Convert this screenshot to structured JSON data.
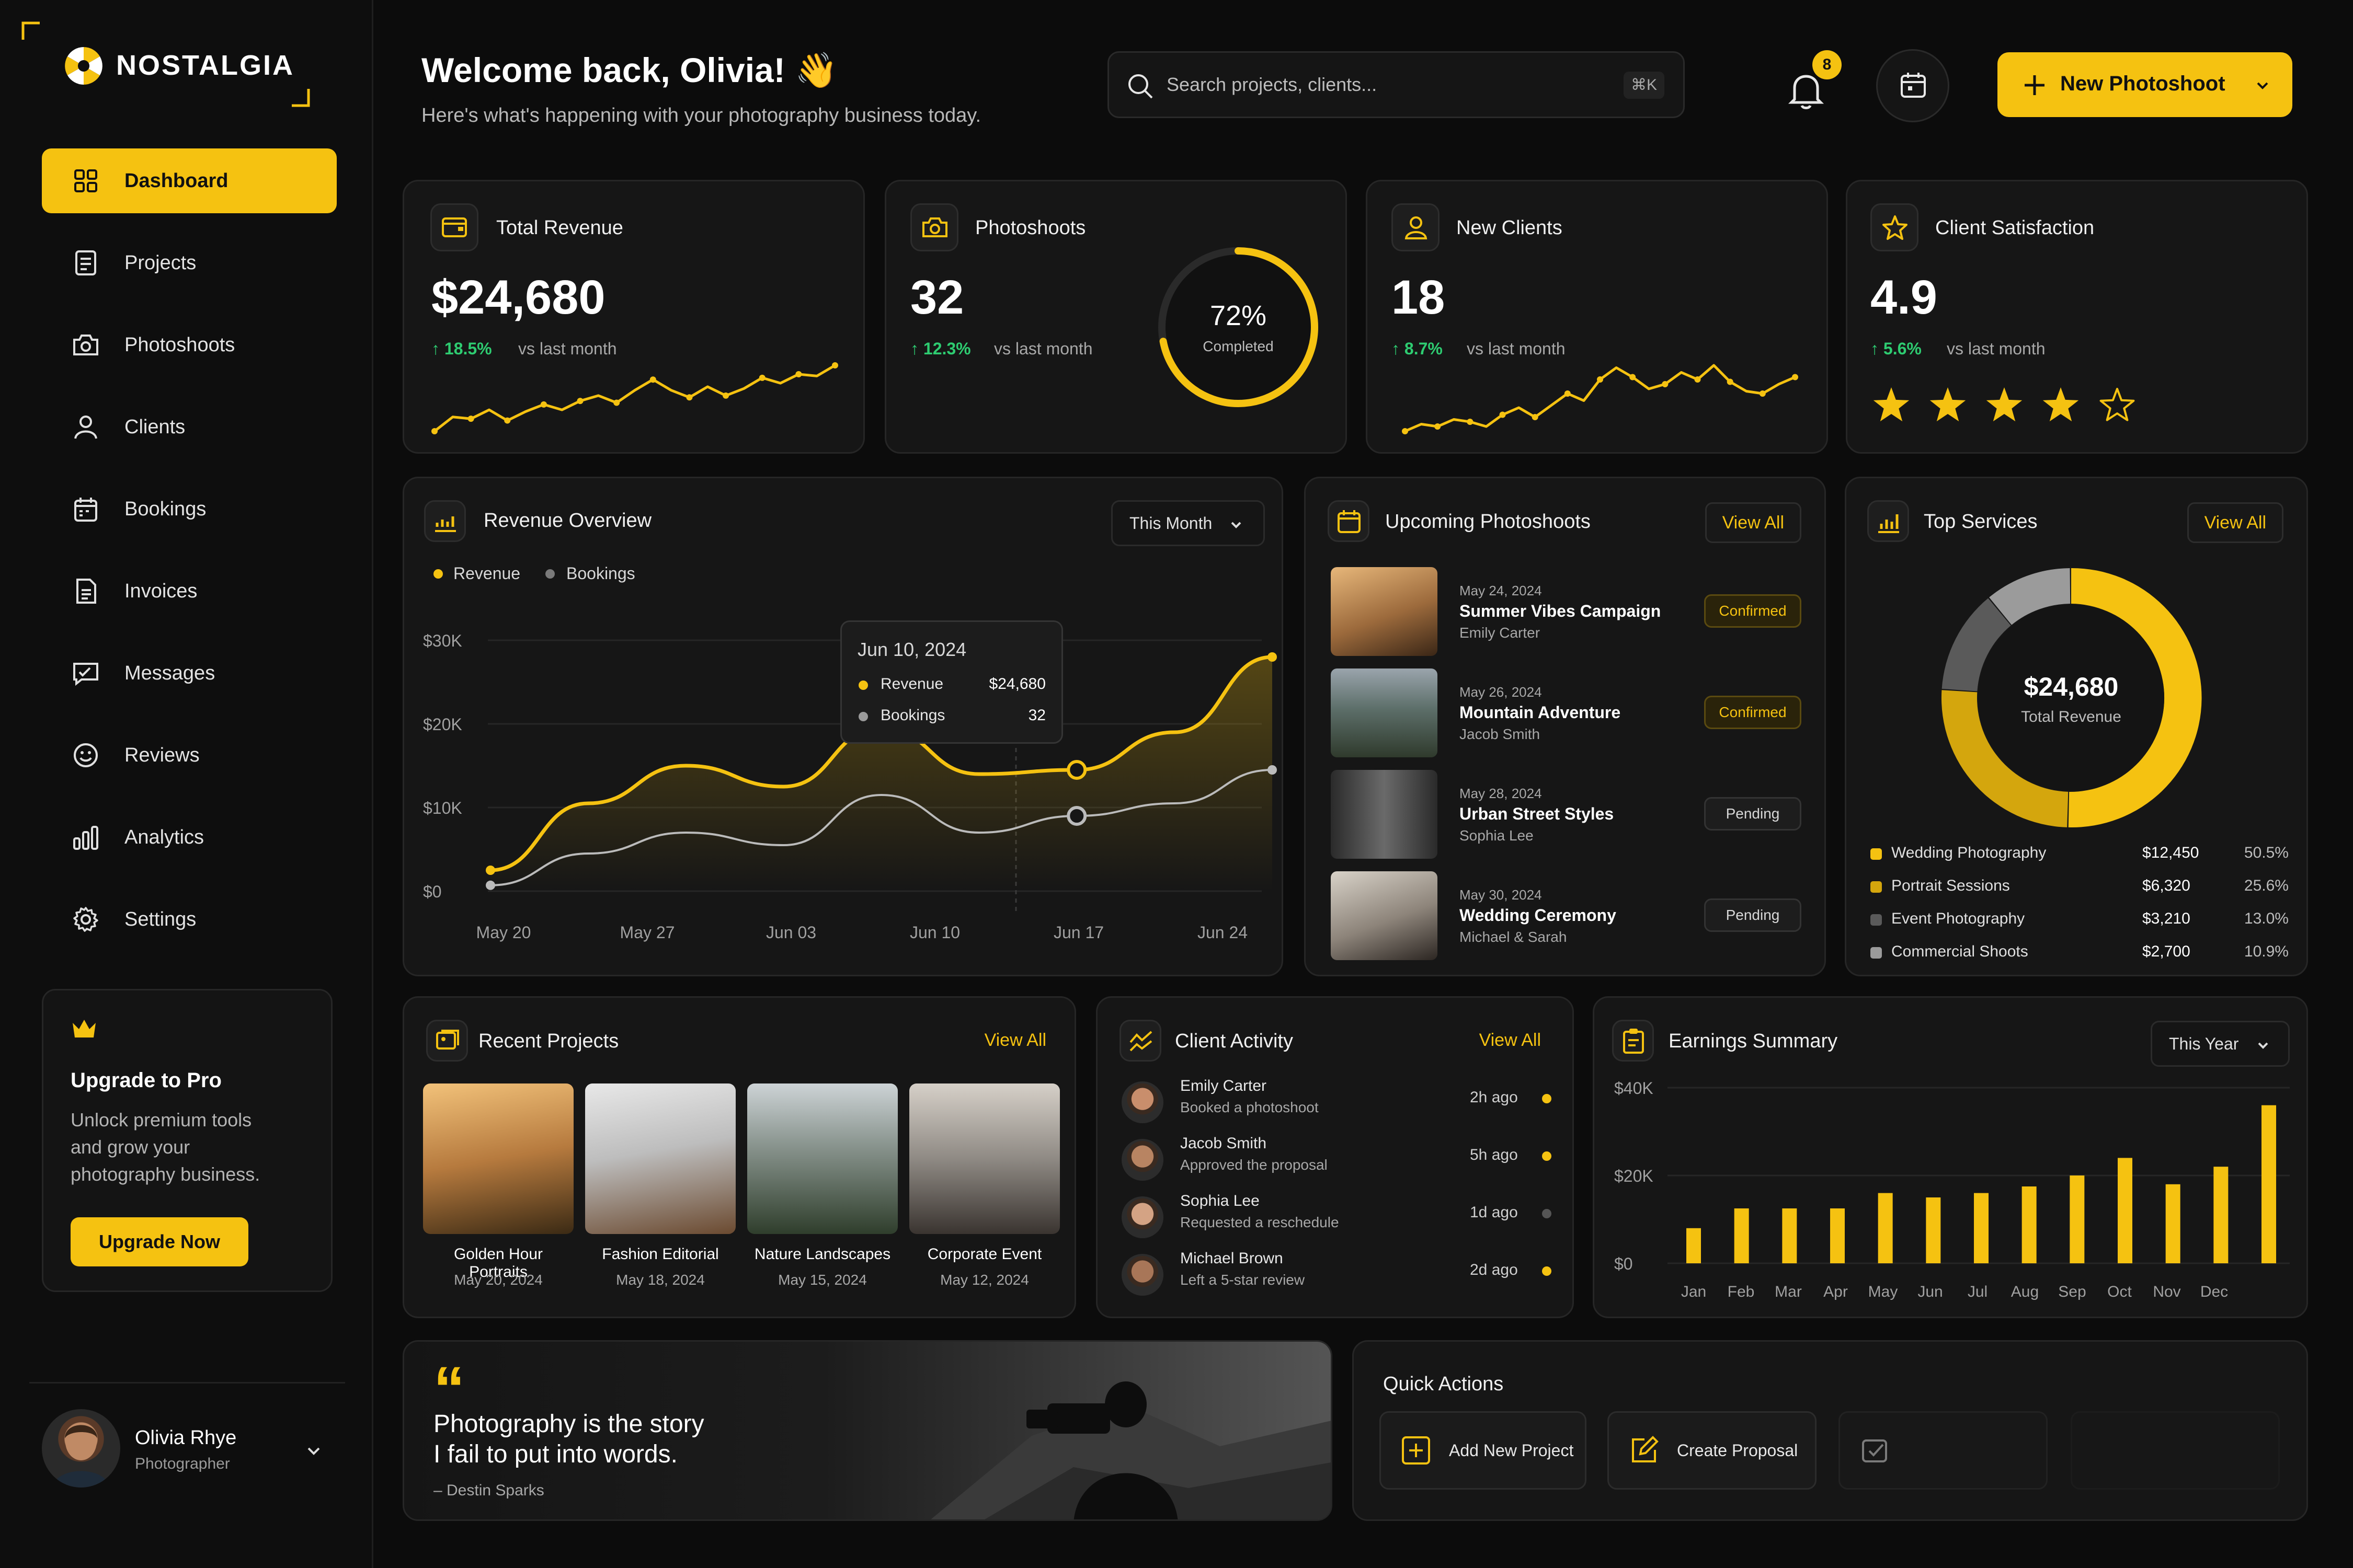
{
  "brand": {
    "name": "NOSTALGIA"
  },
  "sidebar": {
    "items": [
      {
        "label": "Dashboard",
        "icon": "grid-icon",
        "active": true
      },
      {
        "label": "Projects",
        "icon": "projects-icon"
      },
      {
        "label": "Photoshoots",
        "icon": "camera-icon"
      },
      {
        "label": "Clients",
        "icon": "user-icon"
      },
      {
        "label": "Bookings",
        "icon": "calendar-icon"
      },
      {
        "label": "Invoices",
        "icon": "invoice-icon"
      },
      {
        "label": "Messages",
        "icon": "message-icon"
      },
      {
        "label": "Reviews",
        "icon": "smile-icon"
      },
      {
        "label": "Analytics",
        "icon": "bar-chart-icon"
      },
      {
        "label": "Settings",
        "icon": "gear-icon"
      }
    ],
    "upgrade": {
      "title": "Upgrade to Pro",
      "text_line1": "Unlock premium tools",
      "text_line2": "and grow your",
      "text_line3": "photography business.",
      "button": "Upgrade Now"
    },
    "user": {
      "name": "Olivia Rhye",
      "role": "Photographer"
    }
  },
  "header": {
    "welcome": "Welcome back, Olivia! 👋",
    "subtitle": "Here's what's happening with your photography business today.",
    "search_placeholder": "Search projects, clients...",
    "search_shortcut": "⌘K",
    "notification_count": "8",
    "new_button": "New Photoshoot"
  },
  "stats": {
    "revenue": {
      "title": "Total Revenue",
      "value": "$24,680",
      "change": "↑ 18.5%",
      "vs": "vs last month",
      "spark": [
        10,
        18,
        17,
        22,
        16,
        21,
        25,
        22,
        27,
        30,
        26,
        33,
        39,
        33,
        29,
        35,
        30,
        34,
        40,
        37,
        42,
        41,
        47
      ]
    },
    "photoshoots": {
      "title": "Photoshoots",
      "value": "32",
      "change": "↑ 12.3%",
      "vs": "vs last month",
      "donut_percent": 72,
      "donut_label": "72%",
      "donut_sub": "Completed"
    },
    "clients": {
      "title": "New Clients",
      "value": "18",
      "change": "↑ 8.7%",
      "vs": "vs last month",
      "spark": [
        8,
        11,
        10,
        13,
        12,
        10,
        15,
        18,
        14,
        19,
        24,
        21,
        30,
        35,
        31,
        26,
        28,
        33,
        30,
        36,
        29,
        25,
        24,
        28,
        31
      ]
    },
    "satisfaction": {
      "title": "Client Satisfaction",
      "value": "4.9",
      "change": "↑ 5.6%",
      "vs": "vs last month",
      "stars": 4.9
    }
  },
  "revenue_overview": {
    "title": "Revenue Overview",
    "period": "This Month",
    "legend": [
      "Revenue",
      "Bookings"
    ],
    "tooltip": {
      "date": "Jun 10, 2024",
      "revenue_label": "Revenue",
      "revenue_value": "$24,680",
      "bookings_label": "Bookings",
      "bookings_value": "32"
    }
  },
  "chart_data": {
    "type": "line",
    "x": [
      "May 20",
      "May 27",
      "Jun 03",
      "Jun 10",
      "Jun 17",
      "Jun 24"
    ],
    "yticks": [
      "$30K",
      "$20K",
      "$10K",
      "$0"
    ],
    "ylim": [
      0,
      30000
    ],
    "series": [
      {
        "name": "Revenue",
        "color": "#f5c211",
        "values": [
          2500,
          10500,
          15000,
          12500,
          19500,
          14000,
          14500,
          19000,
          28000
        ]
      },
      {
        "name": "Bookings",
        "color": "#bbbbbb",
        "values": [
          700,
          4500,
          7000,
          5500,
          11500,
          7000,
          9000,
          10500,
          14500
        ]
      }
    ],
    "grid": true,
    "legend_position": "top-left"
  },
  "upcoming": {
    "title": "Upcoming Photoshoots",
    "view_all": "View All",
    "items": [
      {
        "date": "May 24, 2024",
        "title": "Summer Vibes Campaign",
        "client": "Emily Carter",
        "status": "Confirmed"
      },
      {
        "date": "May 26, 2024",
        "title": "Mountain Adventure",
        "client": "Jacob Smith",
        "status": "Confirmed"
      },
      {
        "date": "May 28, 2024",
        "title": "Urban Street Styles",
        "client": "Sophia Lee",
        "status": "Pending"
      },
      {
        "date": "May 30, 2024",
        "title": "Wedding Ceremony",
        "client": "Michael & Sarah",
        "status": "Pending"
      }
    ]
  },
  "top_services": {
    "title": "Top Services",
    "view_all": "View All",
    "center_value": "$24,680",
    "center_label": "Total Revenue",
    "items": [
      {
        "name": "Wedding Photography",
        "amount": "$12,450",
        "percent": "50.5%",
        "share": 50.5,
        "color": "#f5c211"
      },
      {
        "name": "Portrait Sessions",
        "amount": "$6,320",
        "percent": "25.6%",
        "share": 25.6,
        "color": "#d4a60d"
      },
      {
        "name": "Event Photography",
        "amount": "$3,210",
        "percent": "13.0%",
        "share": 13.0,
        "color": "#5a5a5a"
      },
      {
        "name": "Commercial Shoots",
        "amount": "$2,700",
        "percent": "10.9%",
        "share": 10.9,
        "color": "#9b9b9b"
      }
    ]
  },
  "recent_projects": {
    "title": "Recent Projects",
    "view_all": "View All",
    "items": [
      {
        "name": "Golden Hour Portraits",
        "date": "May 20, 2024"
      },
      {
        "name": "Fashion Editorial",
        "date": "May 18, 2024"
      },
      {
        "name": "Nature Landscapes",
        "date": "May 15, 2024"
      },
      {
        "name": "Corporate Event",
        "date": "May 12, 2024"
      }
    ]
  },
  "client_activity": {
    "title": "Client Activity",
    "view_all": "View All",
    "items": [
      {
        "name": "Emily Carter",
        "action": "Booked a photoshoot",
        "time": "2h ago",
        "active": true
      },
      {
        "name": "Jacob Smith",
        "action": "Approved the proposal",
        "time": "5h ago",
        "active": true
      },
      {
        "name": "Sophia Lee",
        "action": "Requested a reschedule",
        "time": "1d ago",
        "active": false
      },
      {
        "name": "Michael Brown",
        "action": "Left a 5-star review",
        "time": "2d ago",
        "active": true
      }
    ]
  },
  "earnings": {
    "title": "Earnings Summary",
    "period": "This Year",
    "yticks": [
      "$40K",
      "$20K",
      "$0"
    ],
    "months": [
      "Jan",
      "Feb",
      "Mar",
      "Apr",
      "May",
      "Jun",
      "Jul",
      "Aug",
      "Sep",
      "Oct",
      "Nov",
      "Dec"
    ],
    "values": [
      8000,
      12500,
      12500,
      12500,
      16000,
      15000,
      16000,
      17500,
      20000,
      24000,
      18000,
      22000,
      36000
    ],
    "ymax": 40000
  },
  "quote": {
    "mark": "“",
    "line1": "Photography is the story",
    "line2": "I fail to put into words.",
    "author": "– Destin Sparks"
  },
  "quick_actions": {
    "title": "Quick Actions",
    "items": [
      "Add New Project",
      "Create Proposal"
    ]
  }
}
